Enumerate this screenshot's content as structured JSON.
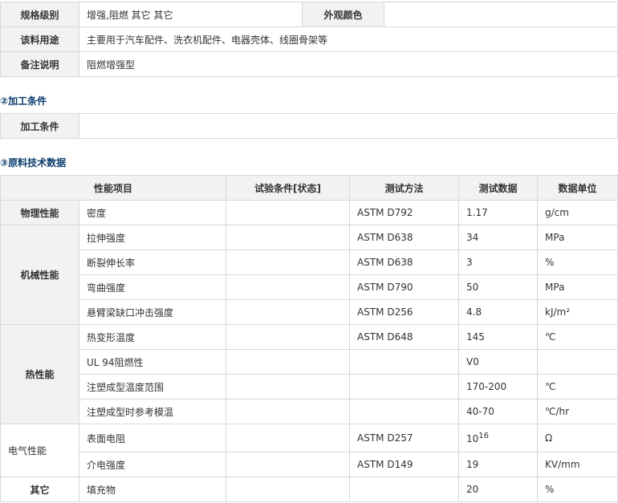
{
  "basic_info": {
    "rows": [
      {
        "label": "规格级别",
        "value": "增强,阻燃 其它 其它",
        "label2": "外观颜色",
        "value2": ""
      },
      {
        "label": "该料用途",
        "value": "主要用于汽车配件、洗衣机配件、电器壳体、线圈骨架等"
      },
      {
        "label": "备注说明",
        "value": "阻燃增强型"
      }
    ]
  },
  "processing": {
    "heading_num": "②",
    "heading": "加工条件",
    "label": "加工条件",
    "value": ""
  },
  "tech_data": {
    "heading_num": "③",
    "heading": "原料技术数据",
    "columns": [
      "性能项目",
      "试验条件[状态]",
      "测试方法",
      "测试数据",
      "数据单位"
    ],
    "groups": [
      {
        "name": "物理性能",
        "rows": [
          {
            "item": "密度",
            "condition": "",
            "method": "ASTM D792",
            "value": "1.17",
            "unit": "g/cm"
          }
        ]
      },
      {
        "name": "机械性能",
        "rows": [
          {
            "item": "拉伸强度",
            "condition": "",
            "method": "ASTM D638",
            "value": "34",
            "unit": "MPa"
          },
          {
            "item": "断裂伸长率",
            "condition": "",
            "method": "ASTM D638",
            "value": "3",
            "unit": "%"
          },
          {
            "item": "弯曲强度",
            "condition": "",
            "method": "ASTM D790",
            "value": "50",
            "unit": "MPa"
          },
          {
            "item": "悬臂梁缺口冲击强度",
            "condition": "",
            "method": "ASTM D256",
            "value": "4.8",
            "unit": "kJ/m²"
          }
        ]
      },
      {
        "name": "热性能",
        "rows": [
          {
            "item": "热变形温度",
            "condition": "",
            "method": "ASTM D648",
            "value": "145",
            "unit": "℃"
          },
          {
            "item": "UL 94阻燃性",
            "condition": "",
            "method": "",
            "value": "V0",
            "unit": ""
          },
          {
            "item": "注塑成型温度范围",
            "condition": "",
            "method": "",
            "value": "170-200",
            "unit": "℃"
          },
          {
            "item": "注塑成型时参考模温",
            "condition": "",
            "method": "",
            "value": "40-70",
            "unit": "℃/hr"
          }
        ]
      },
      {
        "name": "电气性能",
        "rows": [
          {
            "item": "表面电阻",
            "condition": "",
            "method": "ASTM D257",
            "value_base": "10",
            "value_exp": "16",
            "unit": "Ω"
          },
          {
            "item": "介电强度",
            "condition": "",
            "method": "ASTM D149",
            "value": "19",
            "unit": "KV/mm"
          }
        ]
      },
      {
        "name": "其它",
        "rows": [
          {
            "item": "填充物",
            "condition": "",
            "method": "",
            "value": "20",
            "unit": "%"
          }
        ]
      }
    ]
  }
}
